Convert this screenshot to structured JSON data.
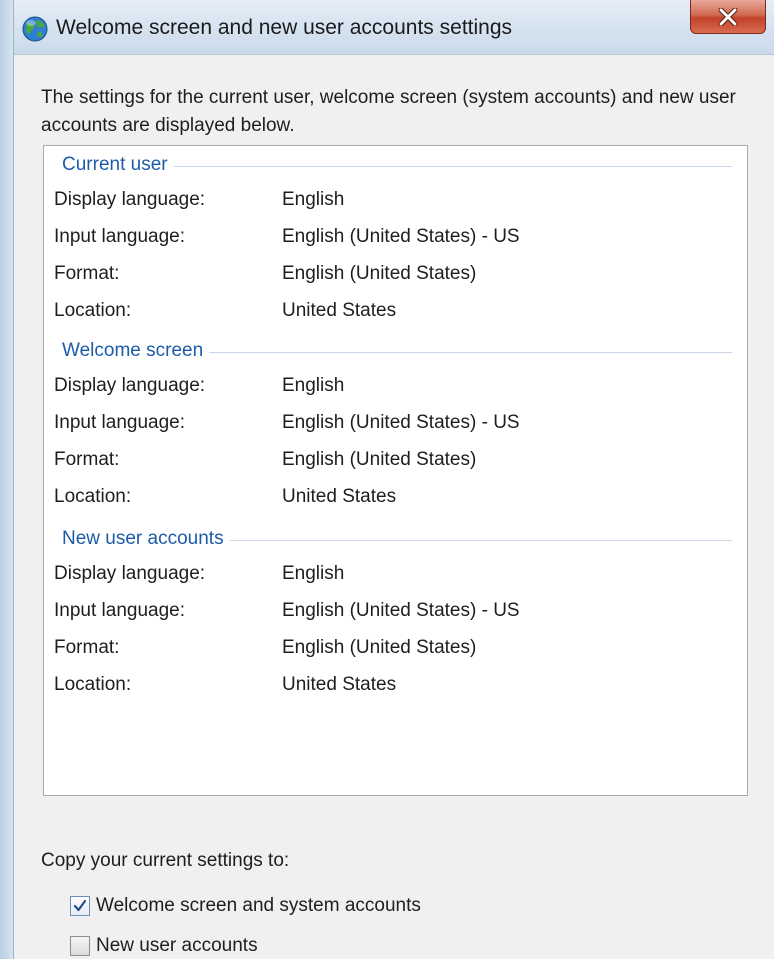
{
  "window": {
    "title": "Welcome screen and new user accounts settings",
    "close_symbol": "X"
  },
  "intro_text": "The settings for the current user, welcome screen (system accounts) and new user accounts are displayed below.",
  "groups": [
    {
      "title": "Current user",
      "rows": [
        {
          "label": "Display language:",
          "value": "English"
        },
        {
          "label": "Input language:",
          "value": "English (United States) - US"
        },
        {
          "label": "Format:",
          "value": "English (United States)"
        },
        {
          "label": "Location:",
          "value": "United States"
        }
      ]
    },
    {
      "title": "Welcome screen",
      "rows": [
        {
          "label": "Display language:",
          "value": "English"
        },
        {
          "label": "Input language:",
          "value": "English (United States) - US"
        },
        {
          "label": "Format:",
          "value": "English (United States)"
        },
        {
          "label": "Location:",
          "value": "United States"
        }
      ]
    },
    {
      "title": "New user accounts",
      "rows": [
        {
          "label": "Display language:",
          "value": "English"
        },
        {
          "label": "Input language:",
          "value": "English (United States) - US"
        },
        {
          "label": "Format:",
          "value": "English (United States)"
        },
        {
          "label": "Location:",
          "value": "United States"
        }
      ]
    }
  ],
  "copy": {
    "label": "Copy your current settings to:",
    "options": [
      {
        "label": "Welcome screen and system accounts",
        "checked": true
      },
      {
        "label": "New user accounts",
        "checked": false
      }
    ]
  },
  "colors": {
    "group_header": "#1d5ca8",
    "close_button": "#c2412a"
  },
  "icons": {
    "title": "globe-icon",
    "close": "close-icon",
    "check": "checkmark-icon"
  }
}
